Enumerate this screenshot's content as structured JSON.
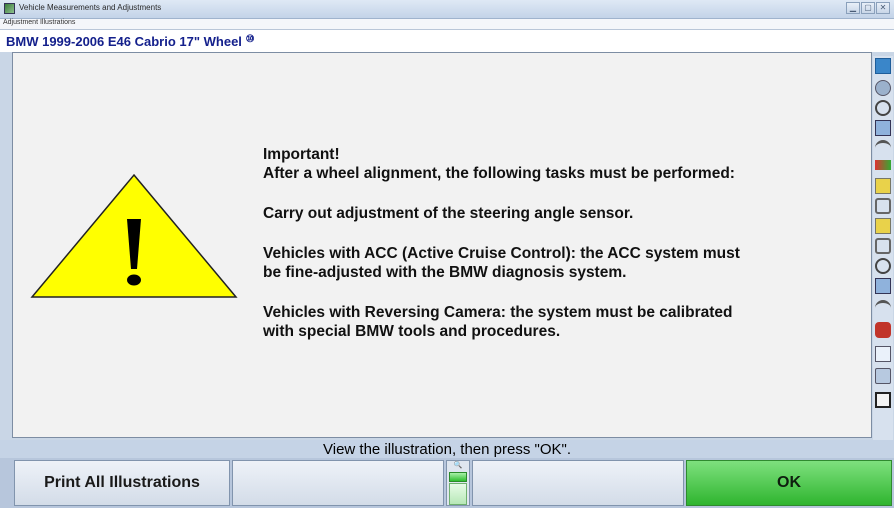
{
  "window": {
    "title": "Vehicle Measurements and Adjustments",
    "subtitle": "Adjustment Illustrations",
    "buttons": [
      "▁",
      "▢",
      "✕"
    ]
  },
  "vehicle": {
    "name": "BMW 1999-2006 E46 Cabrio 17\" Wheel",
    "icon_glyph": "⑩"
  },
  "message": {
    "line1": "Important!",
    "line2": "After a wheel alignment, the following tasks must be performed:",
    "line3": "Carry out adjustment of the steering angle sensor.",
    "line4a": "Vehicles with ACC (Active Cruise Control): the ACC system must",
    "line4b": "be fine-adjusted with the BMW diagnosis system.",
    "line5a": "Vehicles with Reversing Camera: the system must be calibrated",
    "line5b": "with special BMW tools and procedures."
  },
  "status": {
    "text": "View the illustration, then press \"OK\"."
  },
  "buttons": {
    "print_all": "Print All Illustrations",
    "ok": "OK",
    "magnifier": "🔍"
  },
  "colors": {
    "vehicle_name": "#14208c",
    "warning_yellow": "#ffff00",
    "ok_green": "#2fb52f"
  },
  "toolbar_icons": [
    "help-icon",
    "vehicle-top-icon",
    "camber-icon",
    "caster-icon",
    "toe-icon",
    "measure-icon",
    "wheel-icon",
    "steer-icon",
    "level-icon",
    "rear-axle-icon",
    "sensor-icon",
    "rotate-icon",
    "car-icon",
    "print-icon",
    "settings-icon",
    "report-icon"
  ]
}
